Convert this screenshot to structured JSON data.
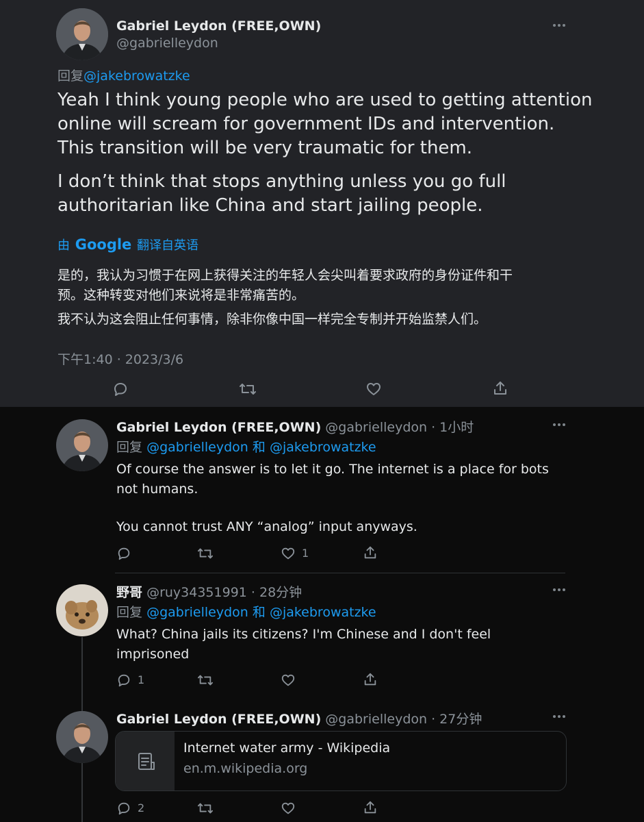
{
  "main_tweet": {
    "author_name": "Gabriel Leydon (FREE,OWN)",
    "handle": "@gabrielleydon",
    "reply_prefix": "回复",
    "reply_to": "@jakebrowatzke",
    "paragraph_1_line_1": "Yeah I think young people who are used to getting attention",
    "paragraph_1_line_2": "online will scream for government IDs and intervention.",
    "paragraph_1_line_3": "This transition will be very traumatic for them.",
    "paragraph_2_line_1": "I don’t think that stops anything unless you go full",
    "paragraph_2_line_2": "authoritarian like China and start jailing people.",
    "translate_prefix": "由",
    "translate_brand": "Google",
    "translate_suffix": "翻译自英语",
    "translation_1_line_1": "是的，我认为习惯于在网上获得关注的年轻人会尖叫着要求政府的身份证件和干",
    "translation_1_line_2": "预。这种转变对他们来说将是非常痛苦的。",
    "translation_2": "我不认为这会阻止任何事情，除非你像中国一样完全专制并开始监禁人们。",
    "timestamp": "下午1:40 · 2023/3/6"
  },
  "reply_1": {
    "author_name": "Gabriel Leydon (FREE,OWN)",
    "handle_time": "@gabrielleydon · 1小时",
    "reply_prefix": "回复",
    "reply_to_1": "@gabrielleydon",
    "reply_joiner": "和",
    "reply_to_2": "@jakebrowatzke",
    "line_1": "Of course the answer is to let it go. The internet is a place for bots",
    "line_2": "not humans.",
    "line_3": "You cannot trust ANY “analog” input anyways.",
    "like_count": "1"
  },
  "reply_2": {
    "author_name": "野哥",
    "handle_time": "@ruy34351991 · 28分钟",
    "reply_prefix": "回复",
    "reply_to_1": "@gabrielleydon",
    "reply_joiner": "和",
    "reply_to_2": "@jakebrowatzke",
    "line_1": "What? China jails its citizens? I'm Chinese and I don't feel",
    "line_2": "imprisoned",
    "reply_count": "1"
  },
  "reply_3": {
    "author_name": "Gabriel Leydon (FREE,OWN)",
    "handle_time": "@gabrielleydon · 27分钟",
    "link_title": "Internet water army - Wikipedia",
    "link_domain": "en.m.wikipedia.org",
    "reply_count": "2"
  },
  "icons": {
    "reply": "reply-icon",
    "retweet": "retweet-icon",
    "like": "heart-icon",
    "share": "share-icon",
    "more": "more-icon",
    "link_thumbnail": "document-icon"
  },
  "colors": {
    "link_blue": "#1d9bf0",
    "muted_text": "#8b9299",
    "top_background": "#222327",
    "bottom_background": "#0c0c0c"
  }
}
